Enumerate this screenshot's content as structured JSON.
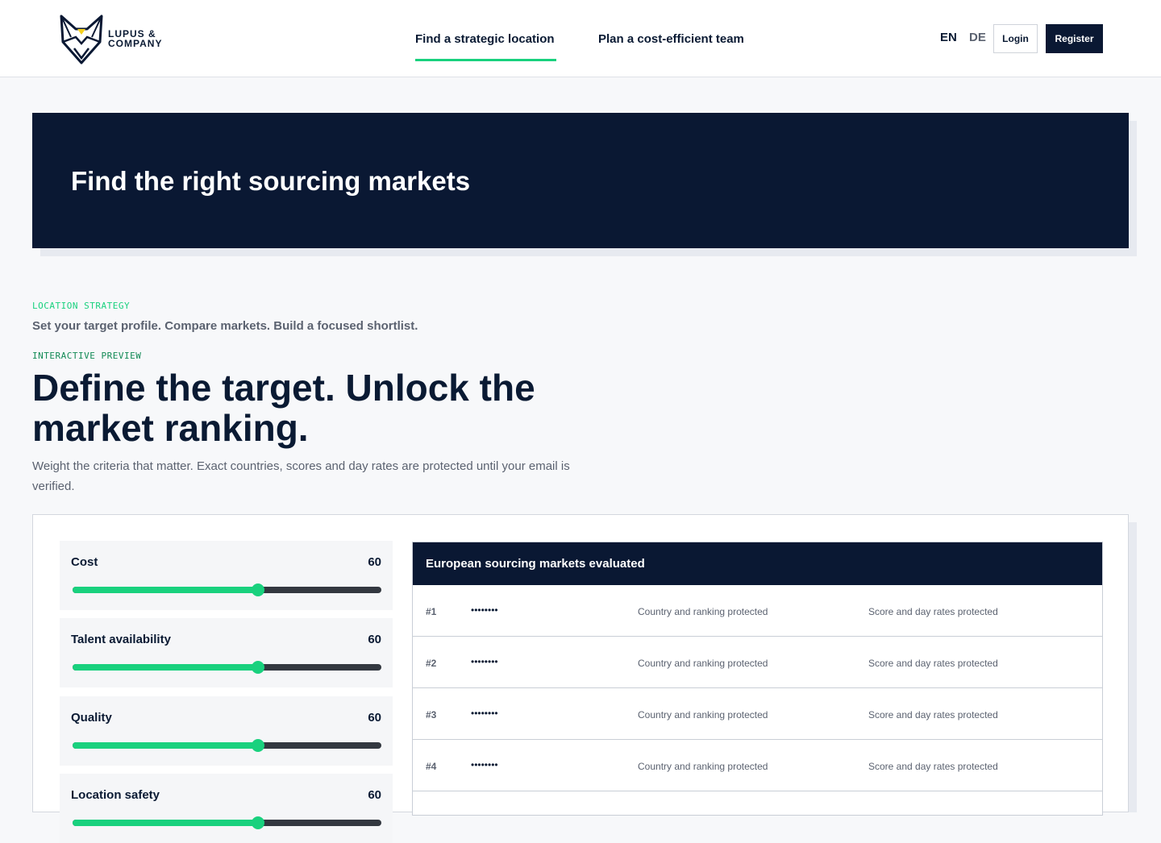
{
  "header": {
    "logo_line1": "LUPUS &",
    "logo_line2": "COMPANY",
    "nav": [
      "Find a strategic location",
      "Plan a cost-efficient team"
    ],
    "languages": [
      "EN",
      "DE"
    ],
    "login_label": "Login",
    "register_label": "Register"
  },
  "hero": {
    "title": "Find the right sourcing markets"
  },
  "intro": {
    "eyebrow": "LOCATION STRATEGY",
    "subline": "Set your target profile. Compare markets. Build a focused shortlist.",
    "preview_label": "INTERACTIVE PREVIEW",
    "headline": "Define the target. Unlock the market ranking.",
    "description": "Weight the criteria that matter. Exact countries, scores and day rates are protected until your email is verified."
  },
  "sliders": [
    {
      "label": "Cost",
      "value": "60",
      "level": 0.6
    },
    {
      "label": "Talent availability",
      "value": "60",
      "level": 0.6
    },
    {
      "label": "Quality",
      "value": "60",
      "level": 0.6
    },
    {
      "label": "Location safety",
      "value": "60",
      "level": 0.6
    }
  ],
  "table": {
    "title": "European sourcing markets evaluated",
    "rows": [
      {
        "rank": "#1",
        "name": "••••••••",
        "country": "Country and ranking protected",
        "score": "Score and day rates protected"
      },
      {
        "rank": "#2",
        "name": "••••••••",
        "country": "Country and ranking protected",
        "score": "Score and day rates protected"
      },
      {
        "rank": "#3",
        "name": "••••••••",
        "country": "Country and ranking protected",
        "score": "Score and day rates protected"
      },
      {
        "rank": "#4",
        "name": "••••••••",
        "country": "Country and ranking protected",
        "score": "Score and day rates protected"
      }
    ]
  },
  "colors": {
    "navy": "#0a1833",
    "accent": "#19d17e"
  }
}
